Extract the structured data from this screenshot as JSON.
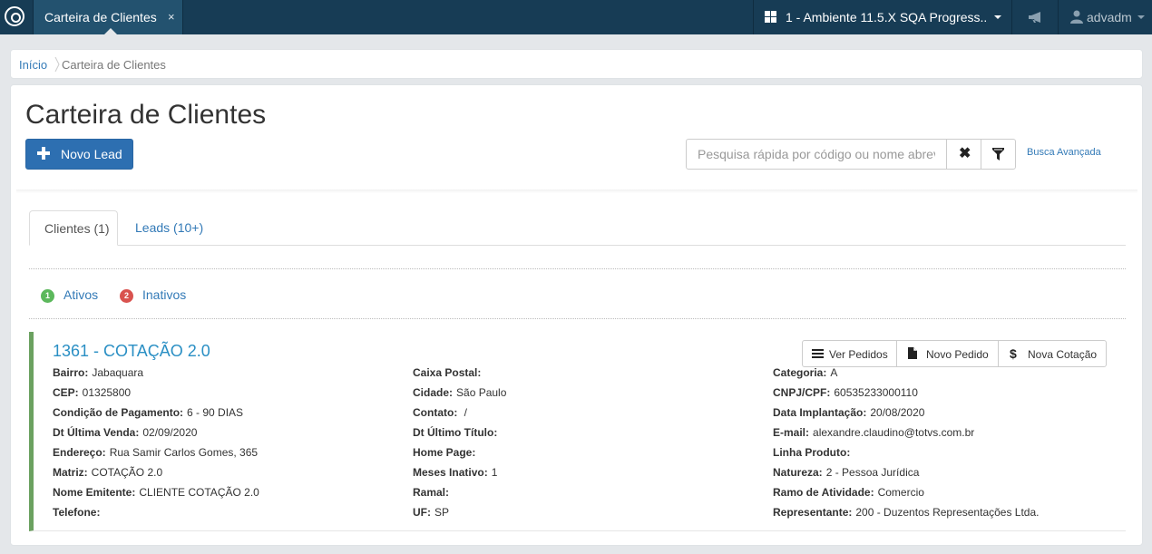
{
  "topbar": {
    "tab_title": "Carteira de Clientes",
    "tab_close": "×",
    "environment": "1 - Ambiente 11.5.X SQA Progress..",
    "user": "advadm"
  },
  "breadcrumb": {
    "home": "Início",
    "current": "Carteira de Clientes"
  },
  "page": {
    "title": "Carteira de Clientes",
    "new_lead_label": "Novo Lead",
    "search_placeholder": "Pesquisa rápida por código ou nome abreviado",
    "clear_label": "✖",
    "advanced_search": "Busca Avançada"
  },
  "tabs": [
    {
      "label": "Clientes (1)"
    },
    {
      "label": "Leads (10+)"
    }
  ],
  "status_filters": {
    "active": {
      "count": "1",
      "label": "Ativos",
      "color": "#5cb85c"
    },
    "inactive": {
      "count": "2",
      "label": "Inativos",
      "color": "#d9534f"
    }
  },
  "client": {
    "title": "1361 - COTAÇÃO 2.0",
    "actions": {
      "view_orders": "Ver Pedidos",
      "new_order": "Novo Pedido",
      "new_quote": "Nova Cotação"
    },
    "columns": [
      [
        {
          "label": "Bairro:",
          "value": "Jabaquara"
        },
        {
          "label": "CEP:",
          "value": "01325800"
        },
        {
          "label": "Condição de Pagamento:",
          "value": "6 - 90 DIAS"
        },
        {
          "label": "Dt Última Venda:",
          "value": "02/09/2020"
        },
        {
          "label": "Endereço:",
          "value": "Rua Samir Carlos Gomes, 365"
        },
        {
          "label": "Matriz:",
          "value": "COTAÇÃO 2.0"
        },
        {
          "label": "Nome Emitente:",
          "value": "CLIENTE COTAÇÃO 2.0"
        },
        {
          "label": "Telefone:",
          "value": ""
        }
      ],
      [
        {
          "label": "Caixa Postal:",
          "value": ""
        },
        {
          "label": "Cidade:",
          "value": "São Paulo"
        },
        {
          "label": "Contato:",
          "value": " /"
        },
        {
          "label": "Dt Último Título:",
          "value": ""
        },
        {
          "label": "Home Page:",
          "value": ""
        },
        {
          "label": "Meses Inativo:",
          "value": "1"
        },
        {
          "label": "Ramal:",
          "value": ""
        },
        {
          "label": "UF:",
          "value": "SP"
        }
      ],
      [
        {
          "label": "Categoria:",
          "value": "A"
        },
        {
          "label": "CNPJ/CPF:",
          "value": "60535233000110"
        },
        {
          "label": "Data Implantação:",
          "value": "20/08/2020"
        },
        {
          "label": "E-mail:",
          "value": "alexandre.claudino@totvs.com.br"
        },
        {
          "label": "Linha Produto:",
          "value": ""
        },
        {
          "label": "Natureza:",
          "value": "2 - Pessoa Jurídica"
        },
        {
          "label": "Ramo de Atividade:",
          "value": "Comercio"
        },
        {
          "label": "Representante:",
          "value": "200 - Duzentos Representações Ltda."
        }
      ]
    ]
  },
  "colors": {
    "topbar": "#173c55",
    "primary": "#2d6fb1",
    "link": "#337ab7",
    "card_accent": "#6ba160"
  }
}
